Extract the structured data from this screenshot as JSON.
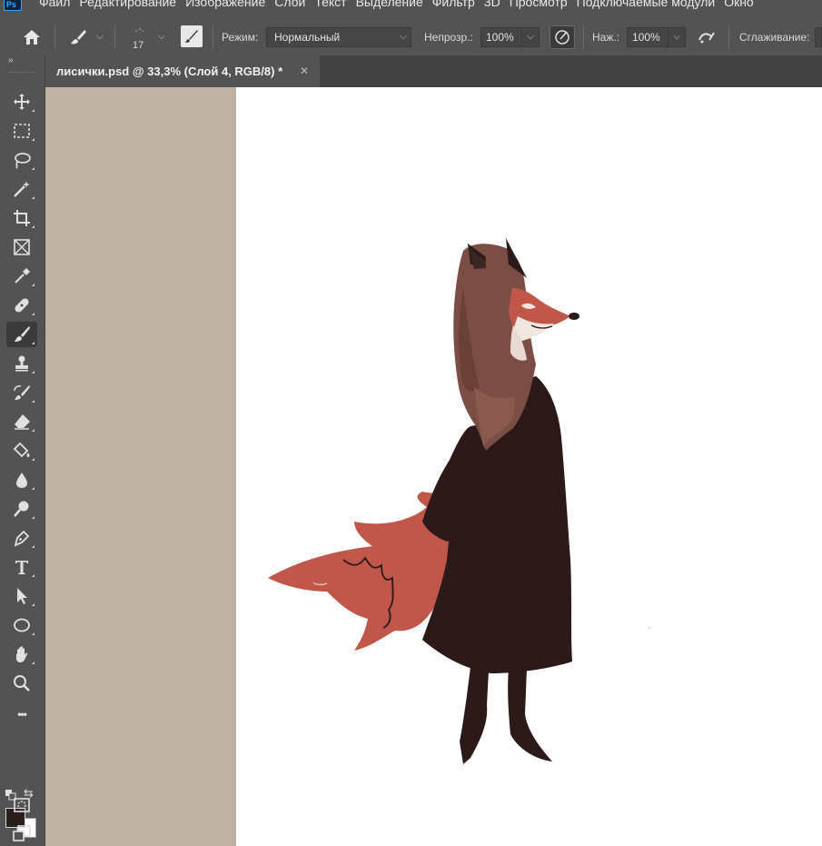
{
  "app": {
    "logo": "Ps"
  },
  "menu": [
    "Файл",
    "Редактирование",
    "Изображение",
    "Слои",
    "Текст",
    "Выделение",
    "Фильтр",
    "3D",
    "Просмотр",
    "Подключаемые модули",
    "Окно"
  ],
  "options": {
    "brush_size": "17",
    "mode_label": "Режим:",
    "mode_value": "Нормальный",
    "opacity_label": "Непрозр.:",
    "opacity_value": "100%",
    "flow_label": "Наж.:",
    "flow_value": "100%",
    "smoothing_label": "Сглаживание:"
  },
  "document": {
    "tab_title": "лисички.psd @ 33,3% (Слой 4, RGB/8) *",
    "close_glyph": "✕"
  },
  "toolbar": {
    "collapse_glyph": "»",
    "more_glyph": "•••",
    "active_tool": "brush",
    "tools": [
      "move",
      "marquee",
      "lasso",
      "magic-wand",
      "crop",
      "frame",
      "eyedropper",
      "healing",
      "brush",
      "clone-stamp",
      "history-brush",
      "eraser",
      "paint-bucket",
      "blur",
      "dodge",
      "pen",
      "type",
      "path-selection",
      "ellipse",
      "hand",
      "zoom",
      "more"
    ],
    "foreground_color": "#2a1f1c",
    "background_color": "#ffffff"
  },
  "colors": {
    "ui_bg": "#535353",
    "pasteboard": "#bdb2a4",
    "fox_fur": "#c0574a",
    "coat": "#2b1a19",
    "hair": "#7a4e44"
  }
}
